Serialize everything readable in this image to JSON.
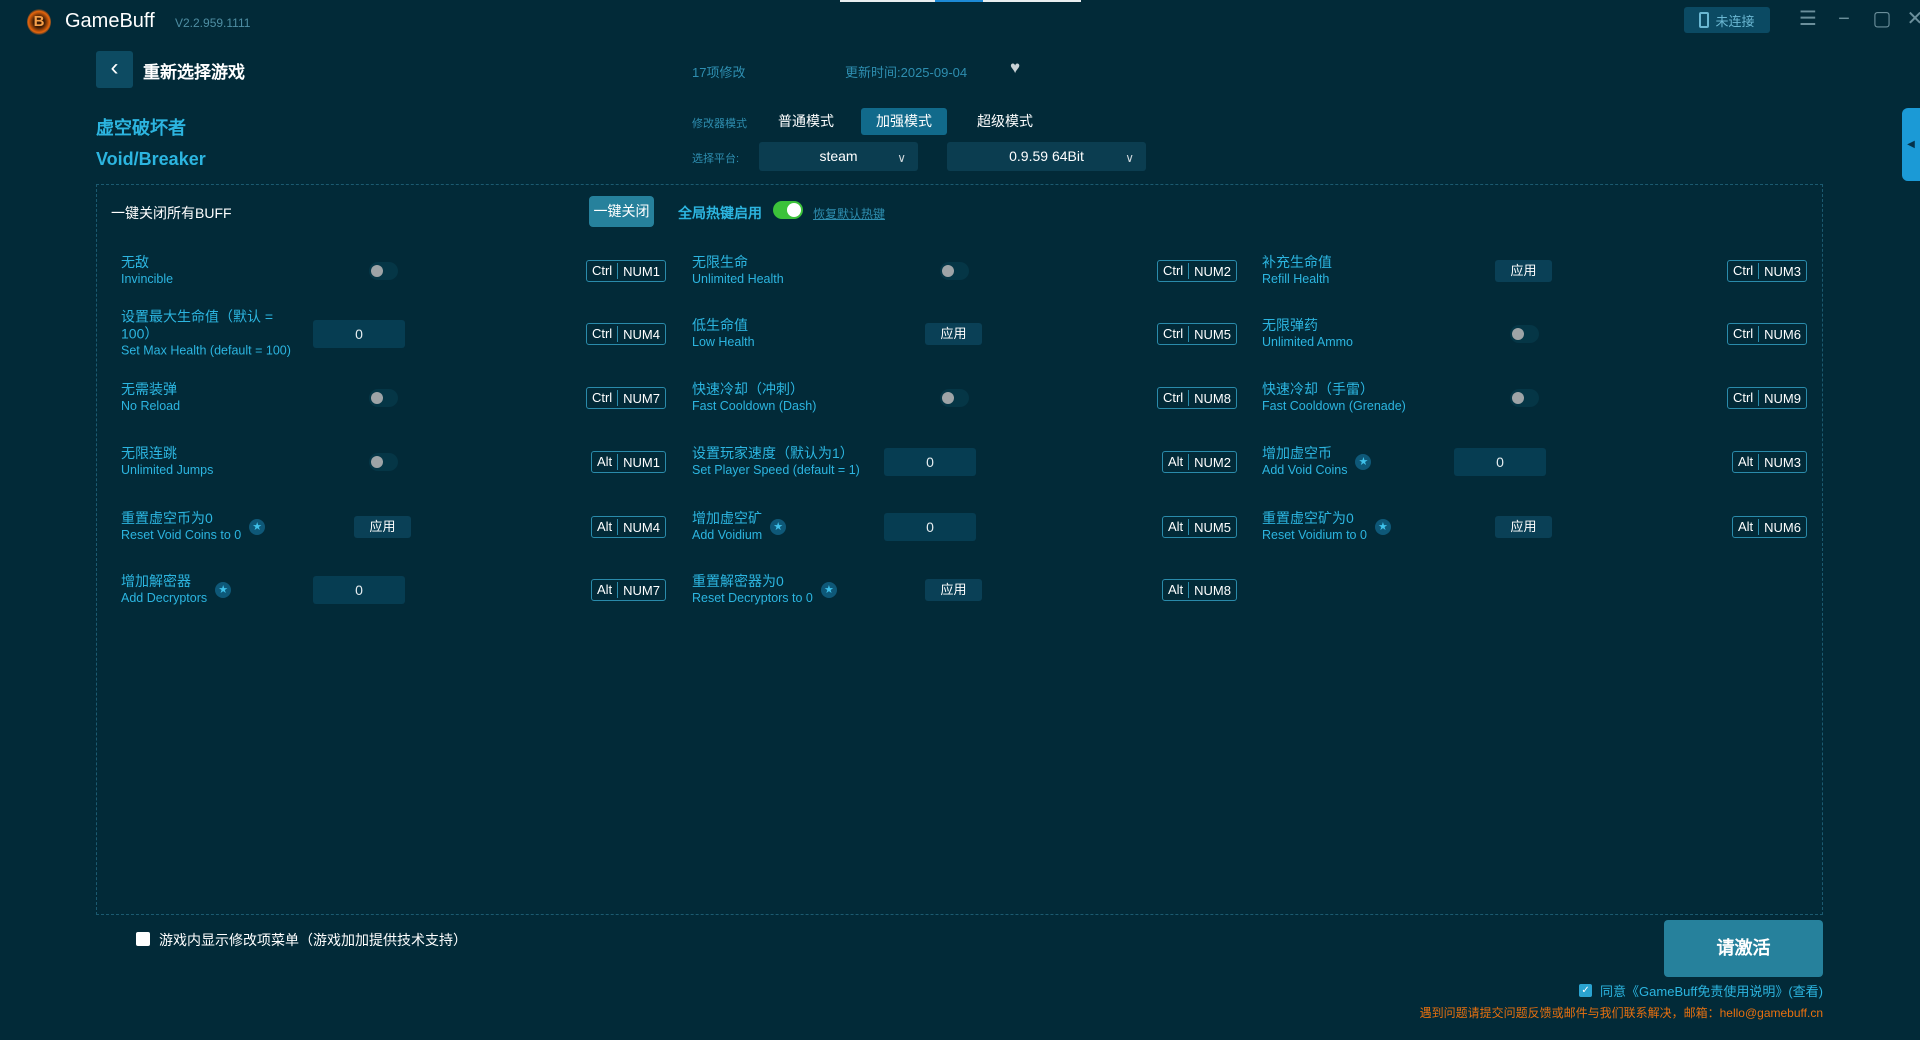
{
  "app": {
    "name": "GameBuff",
    "version": "V2.2.959.1111",
    "logo_letter": "B",
    "connect_label": "未连接"
  },
  "header": {
    "reselect": "重新选择游戏",
    "mod_count": "17项修改",
    "updated": "更新时间:2025-09-04"
  },
  "game": {
    "name_zh": "虚空破坏者",
    "name_en": "Void/Breaker"
  },
  "modes": {
    "label": "修改器模式",
    "items": [
      "普通模式",
      "加强模式",
      "超级模式"
    ],
    "active": 1
  },
  "platform": {
    "label": "选择平台:",
    "selected": "steam",
    "version": "0.9.59 64Bit"
  },
  "panel": {
    "close_all_label": "一键关闭所有BUFF",
    "close_button": "一键关闭",
    "hotkey_label": "全局热键启用",
    "hotkey_enabled": true,
    "restore_hotkeys": "恢复默认热键"
  },
  "cheats": [
    {
      "zh": "无敌",
      "en": "Invincible",
      "control": "toggle",
      "on": false,
      "mod": "Ctrl",
      "key": "NUM1"
    },
    {
      "zh": "无限生命",
      "en": "Unlimited Health",
      "control": "toggle",
      "on": false,
      "mod": "Ctrl",
      "key": "NUM2"
    },
    {
      "zh": "补充生命值",
      "en": "Refill Health",
      "control": "apply",
      "label": "应用",
      "mod": "Ctrl",
      "key": "NUM3"
    },
    {
      "zh": "设置最大生命值（默认 = 100）",
      "en": "Set Max Health (default = 100)",
      "control": "input",
      "value": "0",
      "mod": "Ctrl",
      "key": "NUM4"
    },
    {
      "zh": "低生命值",
      "en": "Low Health",
      "control": "apply",
      "label": "应用",
      "mod": "Ctrl",
      "key": "NUM5"
    },
    {
      "zh": "无限弹药",
      "en": "Unlimited Ammo",
      "control": "toggle",
      "on": false,
      "mod": "Ctrl",
      "key": "NUM6"
    },
    {
      "zh": "无需装弹",
      "en": "No Reload",
      "control": "toggle",
      "on": false,
      "mod": "Ctrl",
      "key": "NUM7"
    },
    {
      "zh": "快速冷却（冲刺）",
      "en": "Fast Cooldown (Dash)",
      "control": "toggle",
      "on": false,
      "mod": "Ctrl",
      "key": "NUM8"
    },
    {
      "zh": "快速冷却（手雷）",
      "en": "Fast Cooldown (Grenade)",
      "control": "toggle",
      "on": false,
      "mod": "Ctrl",
      "key": "NUM9"
    },
    {
      "zh": "无限连跳",
      "en": "Unlimited Jumps",
      "control": "toggle",
      "on": false,
      "mod": "Alt",
      "key": "NUM1"
    },
    {
      "zh": "设置玩家速度（默认为1）",
      "en": "Set Player Speed (default = 1)",
      "control": "input",
      "value": "0",
      "mod": "Alt",
      "key": "NUM2"
    },
    {
      "zh": "增加虚空币",
      "en": "Add Void Coins",
      "star": true,
      "control": "input",
      "value": "0",
      "mod": "Alt",
      "key": "NUM3"
    },
    {
      "zh": "重置虚空币为0",
      "en": "Reset Void Coins to 0",
      "star": true,
      "control": "apply",
      "label": "应用",
      "mod": "Alt",
      "key": "NUM4"
    },
    {
      "zh": "增加虚空矿",
      "en": "Add Voidium",
      "star": true,
      "control": "input",
      "value": "0",
      "mod": "Alt",
      "key": "NUM5"
    },
    {
      "zh": "重置虚空矿为0",
      "en": "Reset Voidium to 0",
      "star": true,
      "control": "apply",
      "label": "应用",
      "mod": "Alt",
      "key": "NUM6"
    },
    {
      "zh": "增加解密器",
      "en": "Add Decryptors",
      "star": true,
      "control": "input",
      "value": "0",
      "mod": "Alt",
      "key": "NUM7"
    },
    {
      "zh": "重置解密器为0",
      "en": "Reset Decryptors to 0",
      "star": true,
      "control": "apply",
      "label": "应用",
      "mod": "Alt",
      "key": "NUM8"
    }
  ],
  "footer": {
    "ingame_menu": "游戏内显示修改项菜单（游戏加加提供技术支持）",
    "ingame_checked": false,
    "activate": "请激活",
    "agree": "同意《GameBuff免责使用说明》(查看)",
    "agree_checked": true,
    "contact": "遇到问题请提交问题反馈或邮件与我们联系解决，邮箱：hello@gamebuff.cn"
  }
}
